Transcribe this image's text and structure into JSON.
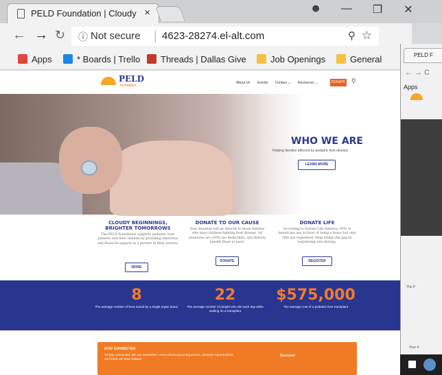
{
  "browser": {
    "tab_title": "PELD Foundation | Cloudy",
    "tab_close": "×",
    "profile_icon": "person-icon",
    "url_info": "ⓘ",
    "url_security": "Not secure",
    "url": "4623-28274.el-alt.com"
  },
  "bookmarks": [
    {
      "label": "Apps",
      "color": "#e0463b"
    },
    {
      "label": "* Boards | Trello",
      "color": "#1e88e5"
    },
    {
      "label": "Threads | Dallas Give",
      "color": "#c0392b"
    },
    {
      "label": "Job Openings",
      "color": "#f6c142"
    },
    {
      "label": "General",
      "color": "#f6c142"
    }
  ],
  "site": {
    "logo_text": "PELD",
    "logo_sub": "foundation",
    "nav": [
      "About Us",
      "Events",
      "Contact ⌄",
      "Resources ⌄"
    ],
    "nav_donate": "DONATE",
    "hero": {
      "title": "WHO WE ARE",
      "subtitle": "Helping families affected by pediatric liver disease",
      "button": "LEARN MORE"
    },
    "columns": [
      {
        "title": "CLOUDY BEGINNINGS, BRIGHTER TOMORROWS",
        "text": "The PELD Foundation supports pediatric liver patients and their families by providing emotional and financial support as a partner in their journey.",
        "button": "MORE"
      },
      {
        "title": "DONATE TO OUR CAUSE",
        "text": "Your donation will go directly to those families who have children fighting liver disease. All donations are 100% tax deductible, and directly benefit those in need.",
        "button": "DONATE"
      },
      {
        "title": "DONATE LIFE",
        "text": "According to Donate Life America, 95% of Americans are in favor of being a donor but only 58% are registered. Help bridge the gap by registering and sharing.",
        "button": "REGISTER"
      }
    ],
    "stats": [
      {
        "num": "8",
        "label": "The average number of lives saved by a single organ donor"
      },
      {
        "num": "22",
        "label": "The average number of people who die each day while waiting on a transplant"
      },
      {
        "num": "$575,000",
        "label": "The average cost of a pediatric liver transplant"
      }
    ],
    "newsletter": {
      "title": "STAY CONNECTED",
      "text": "To stay connected, join our newsletter. Learn about upcoming events, donation opportunities, and those we have helped.",
      "status": "Success!"
    }
  },
  "second_window": {
    "tab": "PELD F",
    "nav": "← →  C",
    "apps": "Apps",
    "text1": "The P",
    "text2": "Your d"
  }
}
